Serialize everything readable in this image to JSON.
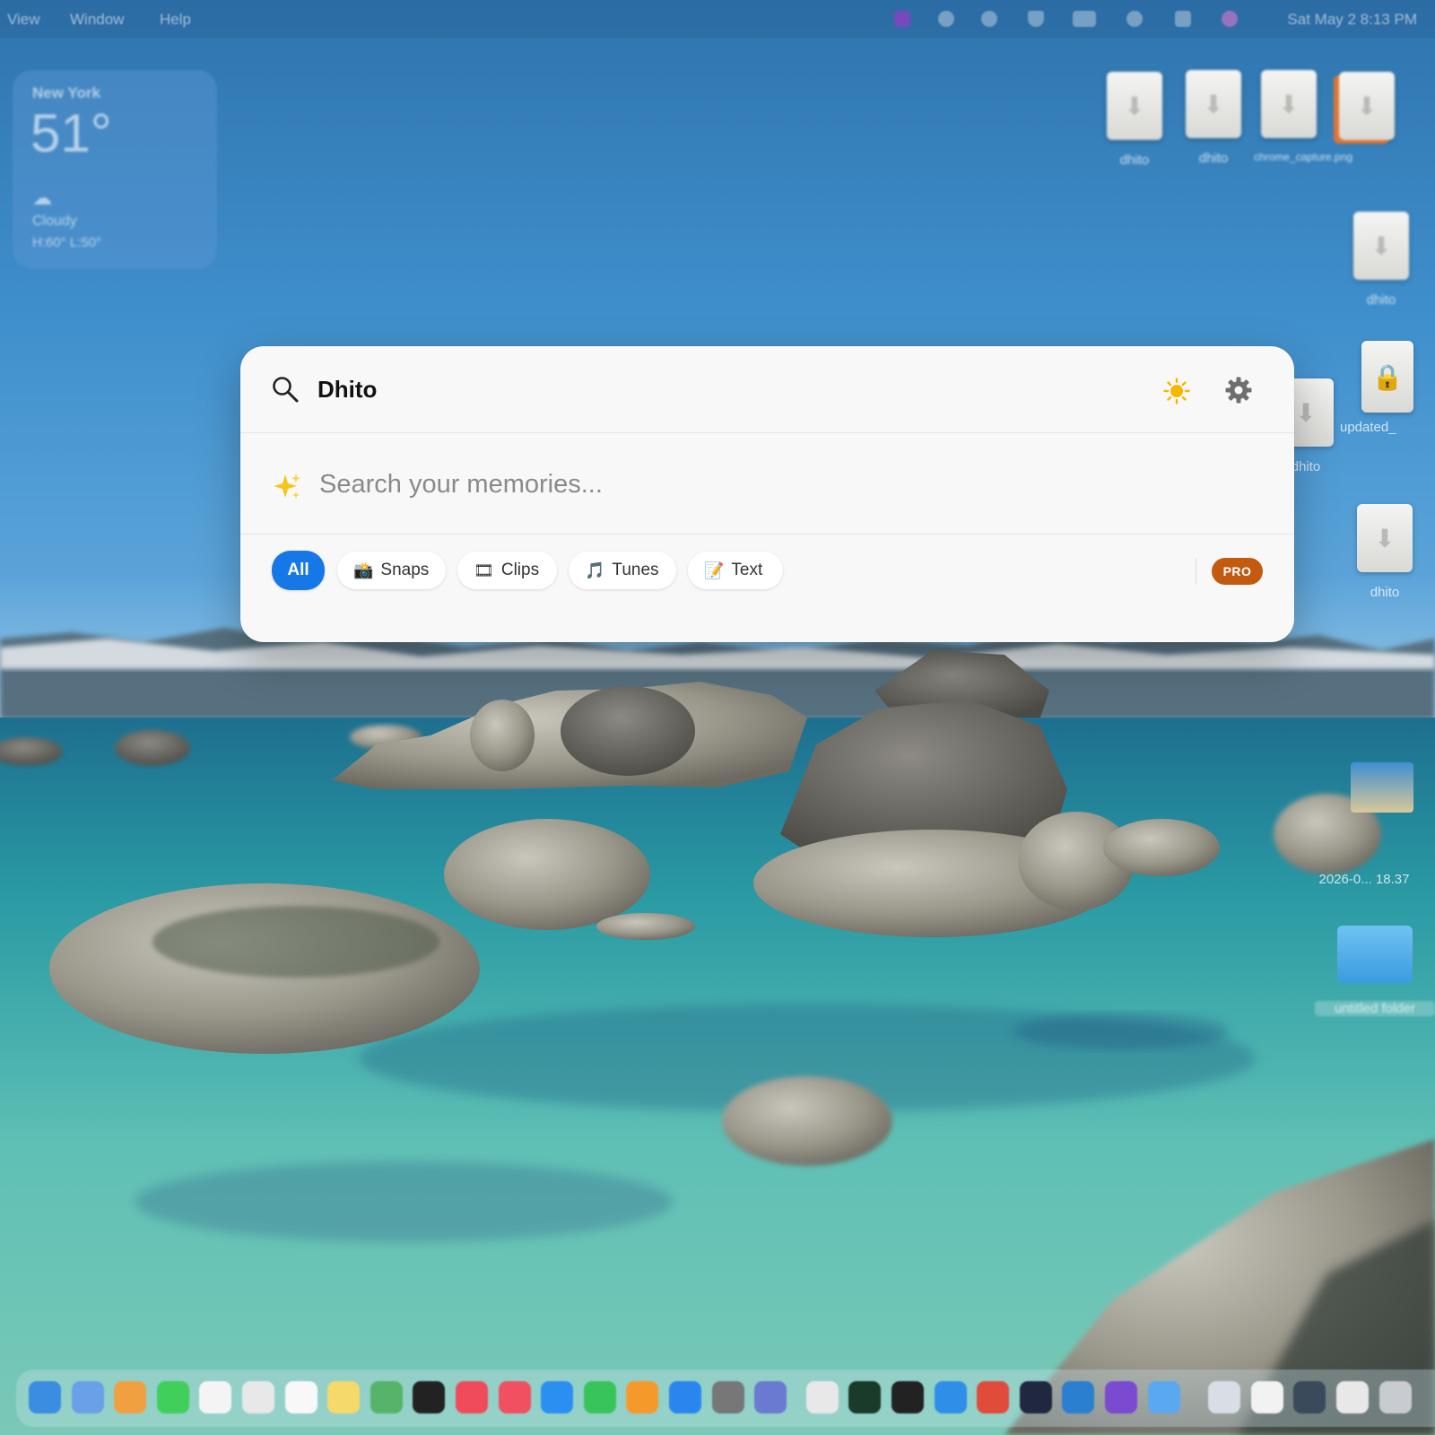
{
  "menubar": {
    "items": [
      "View",
      "Window",
      "Help"
    ],
    "clock": "Sat May 2  8:13 PM"
  },
  "weather": {
    "city": "New York",
    "temperature": "51°",
    "condition": "Cloudy",
    "high_low": "H:60° L:50°"
  },
  "desktop": {
    "icons": [
      {
        "label": "dhito"
      },
      {
        "label": "dhito"
      },
      {
        "label": "chrome_capture.png"
      },
      {
        "label": "dhito"
      },
      {
        "label": "updated_"
      },
      {
        "label": "dhito"
      },
      {
        "label": "dhito"
      },
      {
        "label": "2026-0... 18.37"
      },
      {
        "label": "untitled folder"
      }
    ]
  },
  "spotlight": {
    "query": "Dhito",
    "memory_placeholder": "Search your memories...",
    "filters": [
      {
        "label": "All",
        "emoji": ""
      },
      {
        "label": "Snaps",
        "emoji": "📸"
      },
      {
        "label": "Clips",
        "emoji": "🎞"
      },
      {
        "label": "Tunes",
        "emoji": "🎵"
      },
      {
        "label": "Text",
        "emoji": "📝"
      }
    ],
    "active_filter": "All",
    "badge": "PRO",
    "colors": {
      "accent": "#1677e6",
      "badge": "#c25a10",
      "sun": "#f5b700"
    }
  },
  "dock": {
    "apps": [
      "finder",
      "launchpad",
      "photos",
      "facetime",
      "calendar",
      "contacts",
      "reminders",
      "notes",
      "maps",
      "tv",
      "music",
      "news",
      "keynote",
      "numbers",
      "pages",
      "app-store",
      "system-settings",
      "simulator",
      "chrome",
      "terminal-green",
      "terminal",
      "xcode",
      "mail-app",
      "anthropic",
      "vscode",
      "purple-app",
      "clock-app",
      "finder-window",
      "preview",
      "window-thumb-1",
      "window-thumb-2",
      "trash"
    ]
  }
}
